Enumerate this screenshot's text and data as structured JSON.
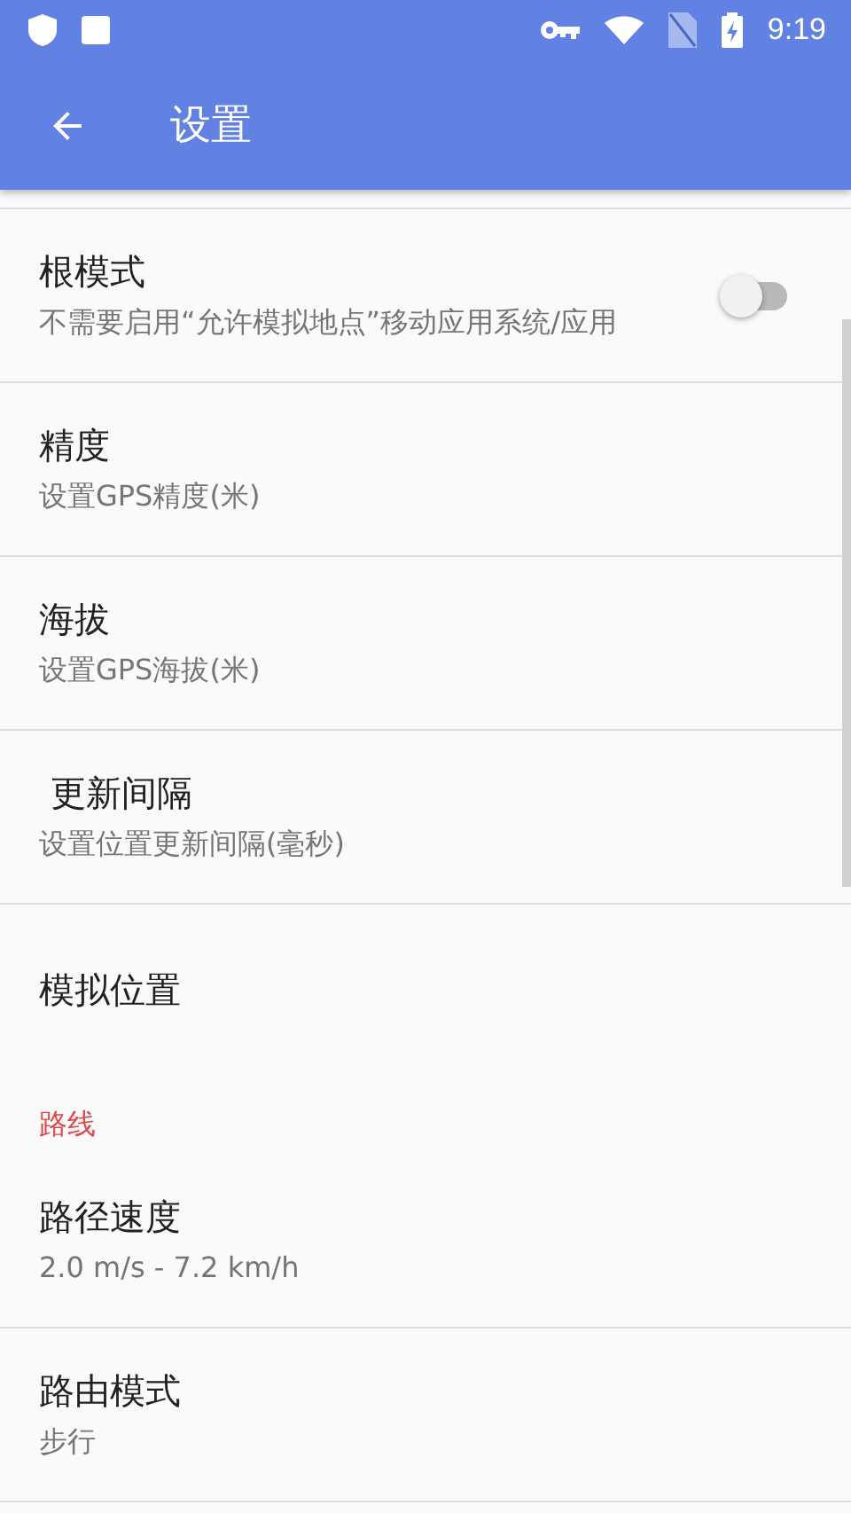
{
  "status_bar": {
    "time": "9:19"
  },
  "toolbar": {
    "title": "设置"
  },
  "items": [
    {
      "kind": "switch",
      "title": "根模式",
      "summary": "不需要启用“允许模拟地点”移动应用系统/应用",
      "on": false
    },
    {
      "kind": "plain",
      "title": "精度",
      "summary": "设置GPS精度(米)"
    },
    {
      "kind": "plain",
      "title": "海拔",
      "summary": "设置GPS海拔(米)"
    },
    {
      "kind": "plain",
      "title": " 更新间隔",
      "summary": "设置位置更新间隔(毫秒)"
    },
    {
      "kind": "plain",
      "title": "模拟位置"
    },
    {
      "kind": "category",
      "title": "路线"
    },
    {
      "kind": "plain",
      "title": "路径速度",
      "summary": "2.0 m/s - 7.2 km/h"
    },
    {
      "kind": "plain",
      "title": "路由模式",
      "summary": "步行"
    }
  ]
}
